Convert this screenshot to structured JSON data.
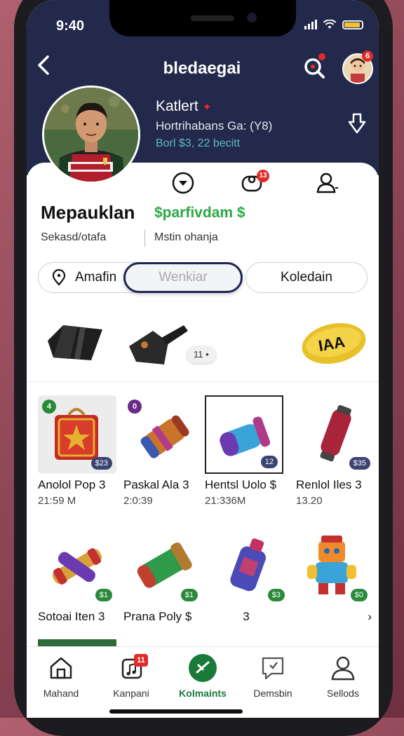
{
  "status": {
    "time": "9:40"
  },
  "header": {
    "title": "bledaegai",
    "notif_count": "6"
  },
  "profile": {
    "name": "Katlert",
    "subtitle": "Hortrihabans Ga: (Y8)",
    "stat": "Borl $3, 22 becitt"
  },
  "quick_actions": {
    "msg_count": "13"
  },
  "section": {
    "title": "Mepauklan",
    "accent": "$parfivdam $",
    "sub_left": "Sekasd/otafa",
    "sub_right": "Mstin ohanja"
  },
  "tabs": [
    {
      "label": "Amafin"
    },
    {
      "label": "Wenkiar"
    },
    {
      "label": "Koledain"
    }
  ],
  "featured": {
    "pill": "11 •",
    "ball_text": "IAA"
  },
  "items": [
    {
      "name": "Anolol Pop 3",
      "time": "21:59 M",
      "tag": "$23",
      "corner": "4"
    },
    {
      "name": "Paskal Ala 3",
      "time": "2:0:39",
      "tag": "",
      "corner": "0"
    },
    {
      "name": "Hentsl Uolo $",
      "time": "21:336M",
      "tag": "12",
      "corner": ""
    },
    {
      "name": "Renlol Iles 3",
      "time": "13.20",
      "tag": "$35",
      "corner": ""
    },
    {
      "name": "Sotoai Iten 3",
      "time": "",
      "tag": "$1",
      "corner": ""
    },
    {
      "name": "Prana Poly $",
      "time": "",
      "tag": "$1",
      "corner": ""
    },
    {
      "name": "3",
      "time": "",
      "tag": "$3",
      "corner": ""
    },
    {
      "name": "›",
      "time": "",
      "tag": "$0",
      "corner": ""
    }
  ],
  "nav": [
    {
      "label": "Mahand"
    },
    {
      "label": "Kanpani",
      "badge": "11"
    },
    {
      "label": "Kolmaints"
    },
    {
      "label": "Demsbin"
    },
    {
      "label": "Sellods"
    }
  ],
  "colors": {
    "header_bg": "#22294a",
    "accent_green": "#2aa844",
    "badge_red": "#e12b2b",
    "tag_navy": "#3b4470"
  }
}
